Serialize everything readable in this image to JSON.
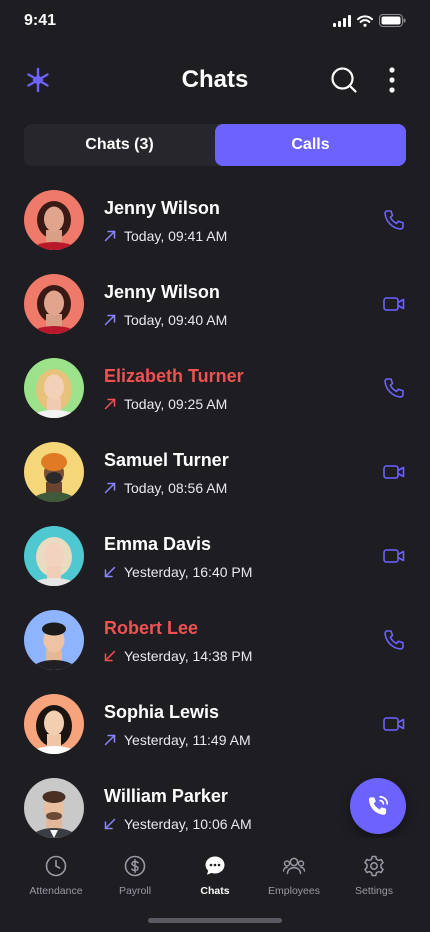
{
  "status": {
    "time": "9:41"
  },
  "header": {
    "title": "Chats"
  },
  "tabs": [
    {
      "label": "Chats (3)",
      "active": false
    },
    {
      "label": "Calls",
      "active": true
    }
  ],
  "colors": {
    "accent": "#6c63ff",
    "missed": "#f05252",
    "background": "#1d1d22"
  },
  "calls": [
    {
      "name": "Jenny Wilson",
      "time": "Today, 09:41 AM",
      "direction": "outgoing",
      "missed": false,
      "type": "voice",
      "avatar_bg": "#f07a6a"
    },
    {
      "name": "Jenny Wilson",
      "time": "Today, 09:40 AM",
      "direction": "outgoing",
      "missed": false,
      "type": "video",
      "avatar_bg": "#f07a6a"
    },
    {
      "name": "Elizabeth Turner",
      "time": "Today, 09:25 AM",
      "direction": "outgoing",
      "missed": true,
      "type": "voice",
      "avatar_bg": "#9be28a"
    },
    {
      "name": "Samuel Turner",
      "time": "Today, 08:56 AM",
      "direction": "outgoing",
      "missed": false,
      "type": "video",
      "avatar_bg": "#f5d77a"
    },
    {
      "name": "Emma Davis",
      "time": "Yesterday, 16:40 PM",
      "direction": "incoming",
      "missed": false,
      "type": "video",
      "avatar_bg": "#4fc8d2"
    },
    {
      "name": "Robert Lee",
      "time": "Yesterday, 14:38 PM",
      "direction": "incoming",
      "missed": true,
      "type": "voice",
      "avatar_bg": "#8fb4ff"
    },
    {
      "name": "Sophia Lewis",
      "time": "Yesterday, 11:49 AM",
      "direction": "outgoing",
      "missed": false,
      "type": "video",
      "avatar_bg": "#f7a37c"
    },
    {
      "name": "William Parker",
      "time": "Yesterday, 10:06 AM",
      "direction": "incoming",
      "missed": false,
      "type": "voice",
      "avatar_bg": "#c9c9c9"
    }
  ],
  "nav": [
    {
      "label": "Attendance",
      "icon": "clock-icon",
      "active": false
    },
    {
      "label": "Payroll",
      "icon": "dollar-icon",
      "active": false
    },
    {
      "label": "Chats",
      "icon": "chat-bubble-icon",
      "active": true
    },
    {
      "label": "Employees",
      "icon": "people-icon",
      "active": false
    },
    {
      "label": "Settings",
      "icon": "gear-icon",
      "active": false
    }
  ]
}
